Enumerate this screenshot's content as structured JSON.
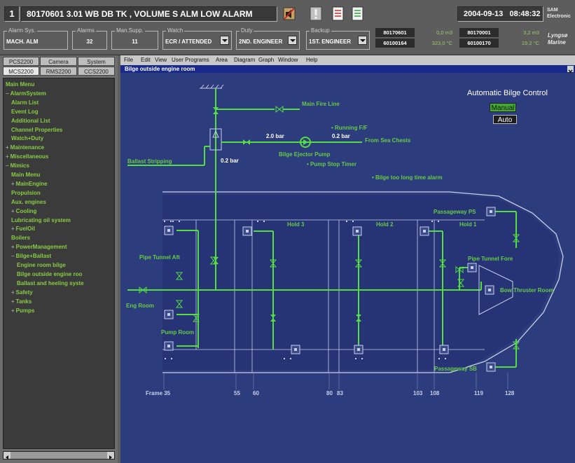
{
  "header": {
    "alarm_number": "1",
    "alarm_text": "80170601 3.01 WB DB TK , VOLUME  S ALM  LOW ALARM",
    "date": "2004-09-13",
    "time": "08:48:32",
    "vendor_line1": "SAM",
    "vendor_line2": "Electronic",
    "brand_line1": "Lyngsø",
    "brand_line2": "Marine",
    "fields": [
      {
        "label": "Alarm Sys.",
        "value": "MACH. ALM"
      },
      {
        "label": "Alarms",
        "value": "32"
      },
      {
        "label": "Man.Supp.",
        "value": "11"
      },
      {
        "label": "Watch",
        "value": "ECR / ATTENDED"
      },
      {
        "label": "Duty",
        "value": "2ND. ENGINEER"
      },
      {
        "label": "Backup",
        "value": "1ST. ENGINEER"
      }
    ],
    "data_table": [
      {
        "tag": "80170601",
        "val": "0,0 m3",
        "tag2": "80170001",
        "val2": "3,2 m3"
      },
      {
        "tag": "60100164",
        "val": "323,0 °C",
        "tag2": "60100170",
        "val2": "19,2 °C"
      }
    ]
  },
  "left_panel": {
    "tabs_row1": [
      "PCS2200",
      "Camera",
      "System"
    ],
    "tabs_row2": [
      "MCS2200",
      "RMS2200",
      "CCS2200"
    ],
    "tree": [
      {
        "label": "Main Menu",
        "level": 0,
        "expander": ""
      },
      {
        "label": "AlarmSystem",
        "level": 0,
        "expander": "−"
      },
      {
        "label": "Alarm List",
        "level": 1,
        "expander": ""
      },
      {
        "label": "Event Log",
        "level": 1,
        "expander": ""
      },
      {
        "label": "Additional List",
        "level": 1,
        "expander": ""
      },
      {
        "label": "Channel Properties",
        "level": 1,
        "expander": ""
      },
      {
        "label": "Watch+Duty",
        "level": 1,
        "expander": ""
      },
      {
        "label": "Maintenance",
        "level": 0,
        "expander": "+"
      },
      {
        "label": "Miscellaneous",
        "level": 0,
        "expander": "+"
      },
      {
        "label": "Mimics",
        "level": 0,
        "expander": "−"
      },
      {
        "label": "Main Menu",
        "level": 1,
        "expander": ""
      },
      {
        "label": "MainEngine",
        "level": 1,
        "expander": "+"
      },
      {
        "label": "Propulsion",
        "level": 1,
        "expander": ""
      },
      {
        "label": "Aux. engines",
        "level": 1,
        "expander": ""
      },
      {
        "label": "Cooling",
        "level": 1,
        "expander": "+"
      },
      {
        "label": "Lubricating oil system",
        "level": 1,
        "expander": ""
      },
      {
        "label": "FuelOil",
        "level": 1,
        "expander": "+"
      },
      {
        "label": "Boilers",
        "level": 1,
        "expander": ""
      },
      {
        "label": "PowerManagement",
        "level": 1,
        "expander": "+"
      },
      {
        "label": "Bilge+Ballast",
        "level": 1,
        "expander": "−"
      },
      {
        "label": "Engine room bilge",
        "level": 2,
        "expander": ""
      },
      {
        "label": "Bilge outside engine roo",
        "level": 2,
        "expander": ""
      },
      {
        "label": "Ballast and heeling syste",
        "level": 2,
        "expander": ""
      },
      {
        "label": "Safety",
        "level": 1,
        "expander": "+"
      },
      {
        "label": "Tanks",
        "level": 1,
        "expander": "+"
      },
      {
        "label": "Pumps",
        "level": 1,
        "expander": "+"
      }
    ]
  },
  "menu": [
    "File",
    "Edit",
    "View",
    "User Programs",
    "Area",
    "Diagram",
    "Graph",
    "Window",
    "Help"
  ],
  "window_title": "Bilge outside engine room",
  "diagram": {
    "control_title": "Automatic Bilge Control",
    "mode_manual": "Manual",
    "mode_auto": "Auto",
    "main_fire_line": "Main Fire Line",
    "running": "• Running F/F",
    "pressure_a": "2.0 bar",
    "pressure_b": "0.2 bar",
    "pressure_c": "0.2 bar",
    "from_sea_chests": "From Sea Chests",
    "ejector_pump": "Bilge Ejector Pump",
    "pump_stop_timer": "• Pump Stop Timer",
    "too_long_alarm": "• Bilge too long time alarm",
    "ballast_stripping": "Ballast Stripping",
    "hold3": "Hold 3",
    "hold2": "Hold 2",
    "hold1": "Hold 1",
    "passageway_ps": "Passageway PS",
    "passageway_sb": "Passageway SB",
    "pipe_tunnel_aft": "Pipe Tunnel Aft",
    "pipe_tunnel_fore": "Pipe Tunnel Fore",
    "bow_thruster_room": "Bow Thruster Room",
    "eng_room": "Eng Room",
    "pump_room": "Pump Room",
    "frame_label": "Frame 35",
    "frames": [
      "55",
      "60",
      "80",
      "83",
      "103",
      "108",
      "119",
      "128"
    ]
  },
  "colors": {
    "pipe": "#55dd44",
    "canvas": "#2d3c7c",
    "hull": "#c8d0e8",
    "label": "#66cc44"
  }
}
